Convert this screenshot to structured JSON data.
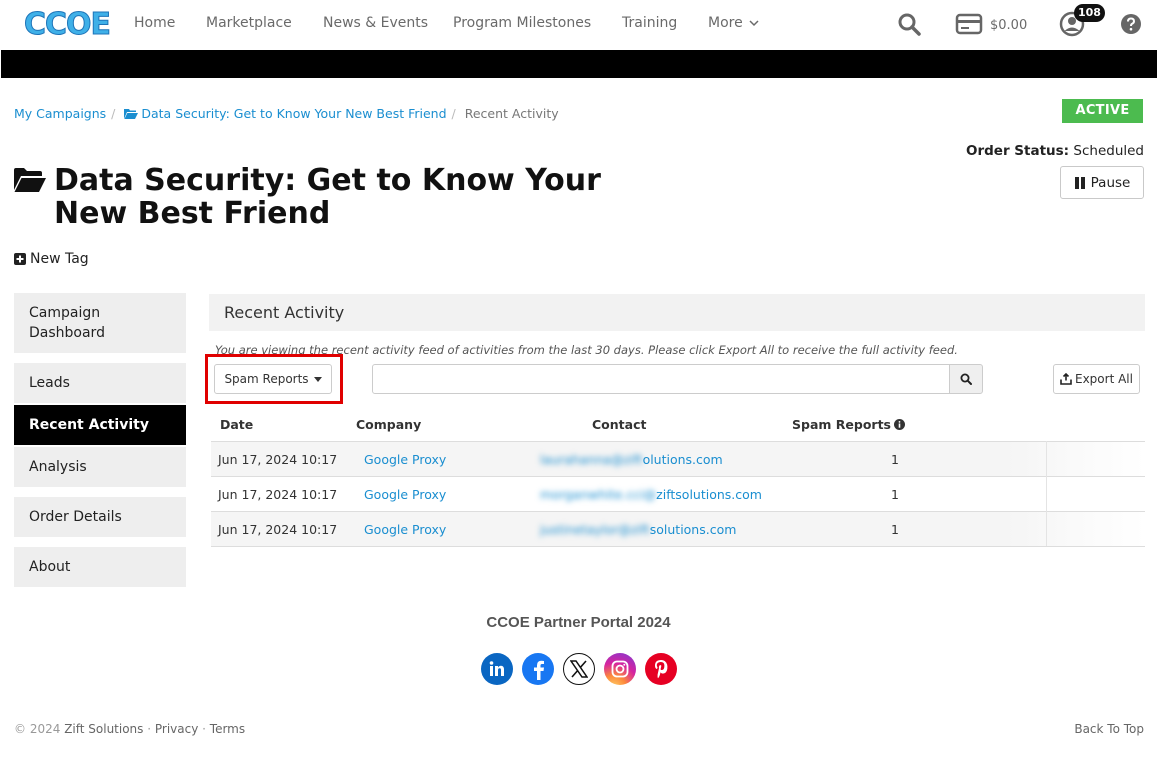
{
  "nav": {
    "logo": "CCOE",
    "items": [
      "Home",
      "Marketplace",
      "News & Events",
      "Program Milestones",
      "Training",
      "More"
    ],
    "wallet_amount": "$0.00",
    "notification_count": "108"
  },
  "breadcrumb": {
    "root": "My Campaigns",
    "campaign": "Data Security: Get to Know Your New Best Friend",
    "current": "Recent Activity"
  },
  "header": {
    "status_badge": "ACTIVE",
    "order_status_label": "Order Status:",
    "order_status_value": "Scheduled",
    "pause_label": "Pause",
    "title": "Data Security: Get to Know Your New Best Friend",
    "new_tag_label": "New Tag"
  },
  "sidebar": {
    "items": [
      {
        "label": "Campaign Dashboard"
      },
      {
        "label": "Leads"
      },
      {
        "label": "Recent Activity"
      },
      {
        "label": "Analysis"
      },
      {
        "label": "Order Details"
      },
      {
        "label": "About"
      }
    ]
  },
  "main": {
    "panel_title": "Recent Activity",
    "info_text": "You are viewing the recent activity feed of activities from the last 30 days. Please click Export All to receive the full activity feed.",
    "filter_label": "Spam Reports",
    "search_value": "",
    "export_label": "Export All",
    "columns": [
      "Date",
      "Company",
      "Contact",
      "Spam Reports"
    ],
    "rows": [
      {
        "date": "Jun 17, 2024 10:17",
        "company": "Google Proxy",
        "contact_hidden": "laurahanna@zift",
        "contact_visible": "olutions.com",
        "count": "1"
      },
      {
        "date": "Jun 17, 2024 10:17",
        "company": "Google Proxy",
        "contact_hidden": "morganwhite.cci@",
        "contact_visible": "ziftsolutions.com",
        "count": "1"
      },
      {
        "date": "Jun 17, 2024 10:17",
        "company": "Google Proxy",
        "contact_hidden": "justinetaylor@zift",
        "contact_visible": "solutions.com",
        "count": "1"
      }
    ]
  },
  "footer": {
    "title": "CCOE Partner Portal 2024",
    "copyright_prefix": "© 2024",
    "company": "Zift Solutions",
    "privacy": "Privacy",
    "terms": "Terms",
    "back_to_top": "Back To Top",
    "social": [
      "linkedin-icon",
      "facebook-icon",
      "x-icon",
      "instagram-icon",
      "pinterest-icon"
    ]
  },
  "colors": {
    "link": "#1a8ed0",
    "active_badge": "#4cbb4f",
    "highlight_box": "#e00000",
    "sidebar_active": "#000000"
  }
}
